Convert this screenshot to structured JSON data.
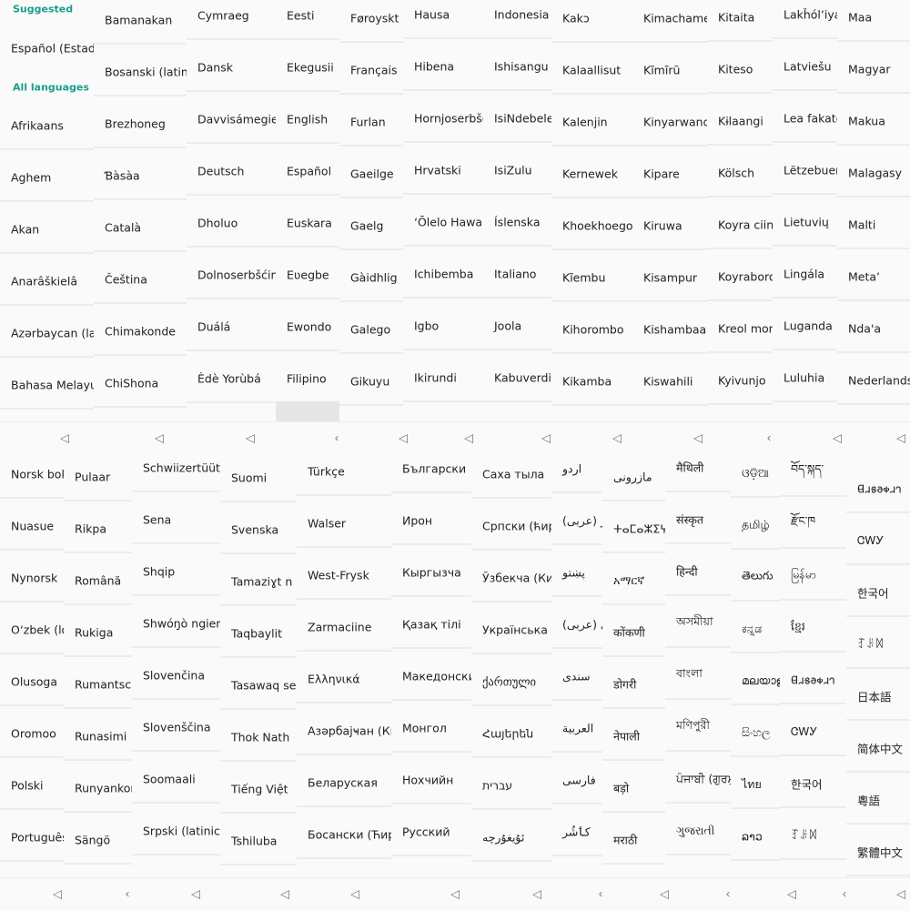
{
  "suggested_header": "Suggested",
  "suggested_item": "Español (Estados Unidos)",
  "all_languages_header": "All languages",
  "top_first_column": [
    "Afrikaans",
    "Aghem",
    "Akan",
    "Anarâškielâ",
    "Azərbaycan (latın)",
    "Bahasa Melayu"
  ],
  "top_columns": [
    [
      "Bamanakan",
      "Bosanski (latinica)",
      "Brezhoneg",
      "Ɓàsàa",
      "Català",
      "Čeština",
      "Chimakonde",
      "ChiShona"
    ],
    [
      "Cymraeg",
      "Dansk",
      "Davvisámegiella",
      "Deutsch",
      "Dholuo",
      "Dolnoserbšćina",
      "Duálá",
      "Èdè Yorùbá"
    ],
    [
      "Eesti",
      "Ekegusii",
      "English",
      "Español",
      "Euskara",
      "Eʋegbe",
      "Ewondo",
      "Filipino"
    ],
    [
      "Føroyskt",
      "Français",
      "Furlan",
      "Gaeilge",
      "Gaelg",
      "Gàidhlig",
      "Galego",
      "Gikuyu"
    ],
    [
      "Hausa",
      "Hibena",
      "Hornjoserbšćina",
      "Hrvatski",
      "ʻŌlelo Hawaiʻi",
      "Ichibemba",
      "Igbo",
      "Ikirundi"
    ],
    [
      "Indonesia",
      "Ishisangu",
      "IsiNdebele",
      "IsiZulu",
      "Íslenska",
      "Italiano",
      "Joola",
      "Kabuverdianu"
    ],
    [
      "Kakɔ",
      "Kalaallisut",
      "Kalenjin",
      "Kernewek",
      "Khoekhoegowab",
      "Kĩembu",
      "Kihorombo",
      "Kikamba"
    ],
    [
      "Kimachame",
      "Kĩmĩrũ",
      "Kinyarwanda",
      "Kipare",
      "Kiruwa",
      "Kisampur",
      "Kishambaa",
      "Kiswahili"
    ],
    [
      "Kitaita",
      "Kiteso",
      "Kɨlaangi",
      "Kölsch",
      "Koyra ciini",
      "Koyraboro senni",
      "Kreol morisien",
      "Kyivunjo"
    ],
    [
      "Lakȟólʼiyapi",
      "Latviešu",
      "Lea fakatonga",
      "Lëtzebuergesch",
      "Lietuvių",
      "Lingála",
      "Luganda",
      "Luluhia"
    ],
    [
      "Maa",
      "Magyar",
      "Makua",
      "Malagasy",
      "Malti",
      "Metaʼ",
      "Ndaꞌa",
      "Nederlands"
    ]
  ],
  "bottom_columns": [
    [
      "Norsk bokmål",
      "Nuasue",
      "Nynorsk",
      "Oʻzbek (lotin)",
      "Olusoga",
      "Oromoo",
      "Polski",
      "Português"
    ],
    [
      "Pulaar",
      "Rikpa",
      "Română",
      "Rukiga",
      "Rumantsch",
      "Runasimi",
      "Runyankore",
      "Sängö"
    ],
    [
      "Schwiizertüütsch",
      "Sena",
      "Shqip",
      "Shwóŋò ngiemboon",
      "Slovenčina",
      "Slovenščina",
      "Soomaali",
      "Srpski (latinica)"
    ],
    [
      "Suomi",
      "Svenska",
      "Tamaziɣt n laṭlaṣ",
      "Taqbaylit",
      "Tasawaq senni",
      "Thok Nath",
      "Tiếng Việt",
      "Tshiluba"
    ],
    [
      "Türkçe",
      "Walser",
      "West-Frysk",
      "Zarmaciine",
      "Ελληνικά",
      "Азәрбајҹан (Кирил)",
      "Беларуская",
      "Босански (Ћирилица)"
    ],
    [
      "Български",
      "Ирон",
      "Кыргызча",
      "Қазақ тілі",
      "Македонски",
      "Монгол",
      "Нохчийн",
      "Русский"
    ],
    [
      "Саха тыла",
      "Српски (ћирилица)",
      "Ўзбекча (Кирил)",
      "Українська",
      "ქართული",
      "Հայերեն",
      "עברית",
      "ئۇيغۇرچە"
    ],
    [
      "اردو",
      "کٲشُر (عربی)",
      "پښتو",
      "پنجابی (عربی)",
      "سندی",
      "العربية",
      "فارسی",
      "کٲشُر"
    ],
    [
      "مازرونی",
      "ⵜⴰⵎⴰⵣⵉⵖⵜ",
      "አማርኛ",
      "कोंकणी",
      "डोगरी",
      "नेपाली",
      "बड़ो",
      "मराठी"
    ],
    [
      "मैथिली",
      "संस्कृत",
      "हिन्दी",
      "অসমীয়া",
      "বাংলা",
      "মণিপুরী",
      "ਪੰਜਾਬੀ (ਗੁਰਮੁਖੀ)",
      "ગુજરાતી"
    ],
    [
      "ଓଡ଼ିଆ",
      "தமிழ்",
      "తెలుగు",
      "ಕನ್ನಡ",
      "മലയാളം",
      "සිංහල",
      "ไทย",
      "ລາວ"
    ],
    [
      "བོད་སྐད་",
      "རྫོང་ཁ",
      "မြန်မာ",
      "ខ្មែរ",
      "𐐔𐐯𐑅𐐨𐑉𐐯𐐻",
      "ᏣᎳᎩ",
      "한국어",
      "ꆈꌠꉙ"
    ],
    [
      "𐐔𐐯𐑅𐐨𐑉𐐯𐐻",
      "ᏣᎳᎩ",
      "한국어",
      "ꆈꌠꉙ",
      "日本語",
      "简体中文",
      "粵語",
      "繁體中文"
    ]
  ],
  "nav": {
    "back_icon": "back-triangle-icon",
    "back_glyph": "◁",
    "small_back_glyph": "‹"
  },
  "colors": {
    "accent": "#1a9e8c",
    "background": "#fafafa",
    "divider": "#ececec"
  }
}
